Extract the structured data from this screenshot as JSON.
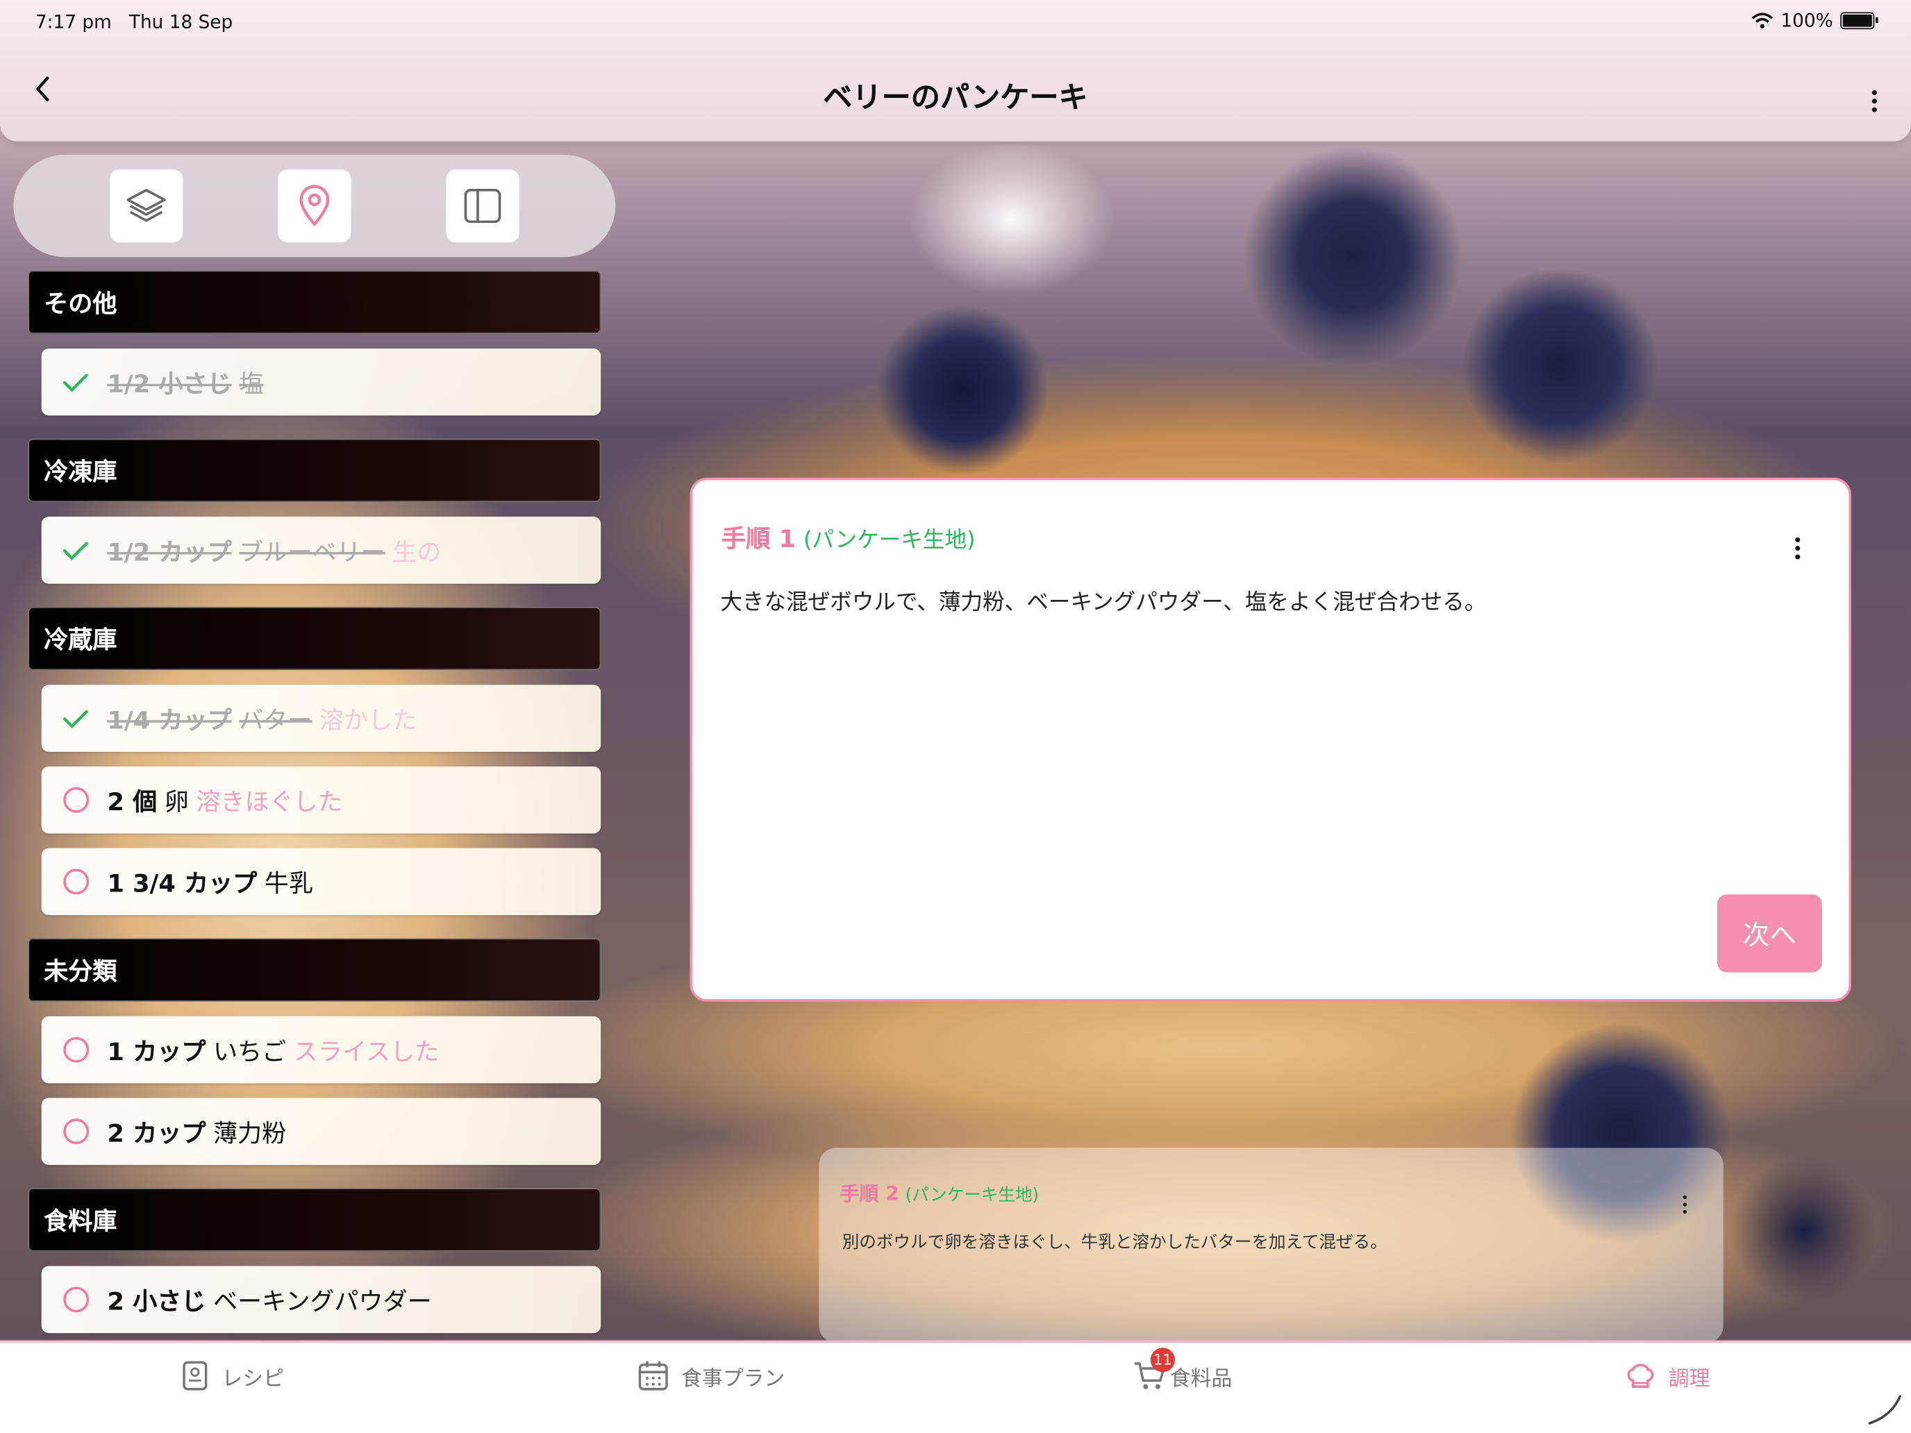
{
  "status": {
    "time": "7:17 pm",
    "date": "Thu 18 Sep",
    "battery": "100%"
  },
  "header": {
    "title": "ベリーのパンケーキ"
  },
  "toolbar": {
    "icons": [
      "layers-icon",
      "location-pin-icon",
      "sidebar-toggle-icon"
    ]
  },
  "sections": [
    {
      "title": "その他",
      "items": [
        {
          "qty": "1/2 小さじ",
          "name": "塩",
          "note": "",
          "done": true
        }
      ]
    },
    {
      "title": "冷凍庫",
      "items": [
        {
          "qty": "1/2 カップ",
          "name": "ブルーベリー",
          "note": "生の",
          "done": true
        }
      ]
    },
    {
      "title": "冷蔵庫",
      "items": [
        {
          "qty": "1/4 カップ",
          "name": "バター",
          "note": "溶かした",
          "done": true
        },
        {
          "qty": "2 個",
          "name": "卵",
          "note": "溶きほぐした",
          "done": false
        },
        {
          "qty": "1 3/4 カップ",
          "name": "牛乳",
          "note": "",
          "done": false
        }
      ]
    },
    {
      "title": "未分類",
      "items": [
        {
          "qty": "1 カップ",
          "name": "いちご",
          "note": "スライスした",
          "done": false
        },
        {
          "qty": "2 カップ",
          "name": "薄力粉",
          "note": "",
          "done": false
        }
      ]
    },
    {
      "title": "食料庫",
      "items": [
        {
          "qty": "2 小さじ",
          "name": "ベーキングパウダー",
          "note": "",
          "done": false
        }
      ]
    }
  ],
  "current_step": {
    "label": "手順 1",
    "group": "(パンケーキ生地)",
    "text": "大きな混ぜボウルで、薄力粉、ベーキングパウダー、塩をよく混ぜ合わせる。",
    "next_label": "次へ"
  },
  "next_step": {
    "label": "手順 2",
    "group": "(パンケーキ生地)",
    "text": "別のボウルで卵を溶きほぐし、牛乳と溶かしたバターを加えて混ぜる。"
  },
  "tabs": [
    {
      "label": "レシピ",
      "icon": "recipe-book-icon",
      "active": false
    },
    {
      "label": "食事プラン",
      "icon": "calendar-icon",
      "active": false
    },
    {
      "label": "食料品",
      "icon": "cart-icon",
      "active": false,
      "badge": "11"
    },
    {
      "label": "調理",
      "icon": "chef-hat-icon",
      "active": true
    }
  ],
  "colors": {
    "accent": "#f27aa0",
    "check": "#2db55d",
    "section_bg": "#000000"
  }
}
